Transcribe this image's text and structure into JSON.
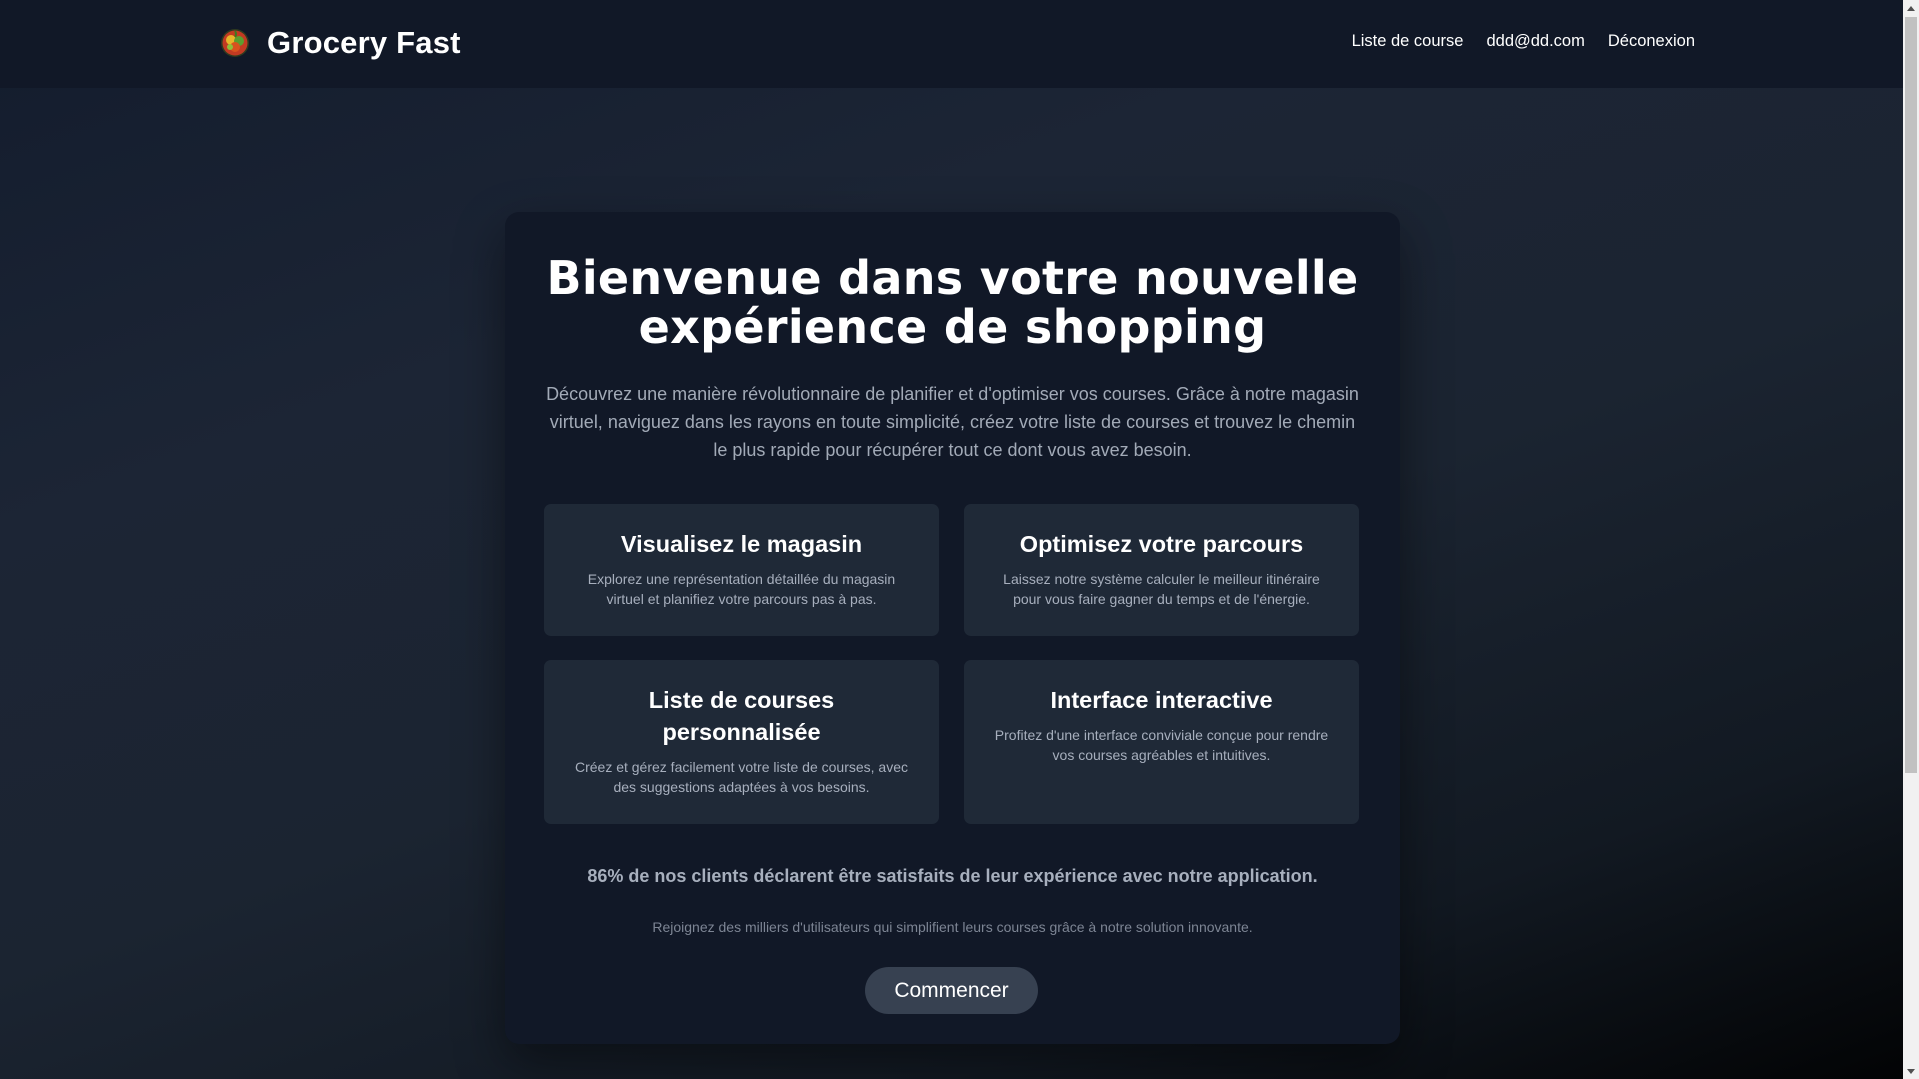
{
  "navbar": {
    "brand_name": "Grocery Fast",
    "logo_icon": "fruit-basket-icon",
    "links": {
      "shopping_list": "Liste de course",
      "user_email": "ddd@dd.com",
      "logout": "Déconexion"
    }
  },
  "hero": {
    "title": "Bienvenue dans votre nouvelle expérience de shopping",
    "description": "Découvrez une manière révolutionnaire de planifier et d'optimiser vos courses. Grâce à notre magasin virtuel, naviguez dans les rayons en toute simplicité, créez votre liste de courses et trouvez le chemin le plus rapide pour récupérer tout ce dont vous avez besoin."
  },
  "features": [
    {
      "title": "Visualisez le magasin",
      "text": "Explorez une représentation détaillée du magasin virtuel et planifiez votre parcours pas à pas."
    },
    {
      "title": "Optimisez votre parcours",
      "text": "Laissez notre système calculer le meilleur itinéraire pour vous faire gagner du temps et de l'énergie."
    },
    {
      "title": "Liste de courses personnalisée",
      "text": "Créez et gérez facilement votre liste de courses, avec des suggestions adaptées à vos besoins."
    },
    {
      "title": "Interface interactive",
      "text": "Profitez d'une interface conviviale conçue pour rendre vos courses agréables et intuitives."
    }
  ],
  "stat_text": "86% de nos clients déclarent être satisfaits de leur expérience avec notre application.",
  "subtext": "Rejoignez des milliers d'utilisateurs qui simplifient leurs courses grâce à notre solution innovante.",
  "cta_label": "Commencer",
  "colors": {
    "navbar_bg": "#111827",
    "card_bg": "#111827",
    "feature_bg": "#1f2937",
    "button_bg": "#374151",
    "muted_text": "#a7afbd"
  }
}
